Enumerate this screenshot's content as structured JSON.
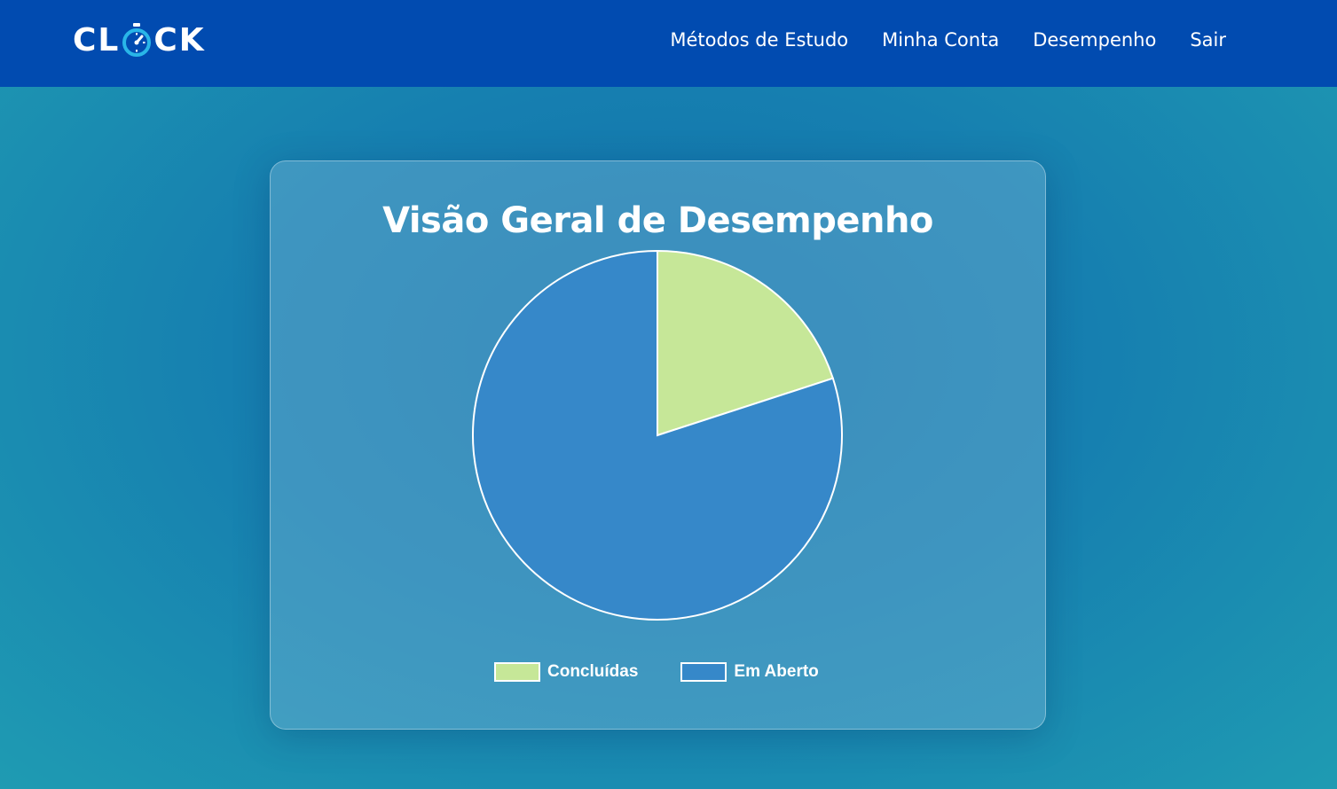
{
  "header": {
    "logo_text": "CLOCK",
    "nav": [
      {
        "label": "Métodos de Estudo"
      },
      {
        "label": "Minha Conta"
      },
      {
        "label": "Desempenho"
      },
      {
        "label": "Sair"
      }
    ]
  },
  "colors": {
    "navbar": "#014bb0",
    "logo_accent": "#29b6e8",
    "concluidas": "#c6e798",
    "em_aberto": "#3688c9"
  },
  "chart_data": {
    "type": "pie",
    "title": "Visão Geral de Desempenho",
    "categories": [
      "Concluídas",
      "Em Aberto"
    ],
    "values": [
      20,
      80
    ],
    "colors": [
      "#c6e798",
      "#3688c9"
    ],
    "legend_position": "bottom"
  }
}
